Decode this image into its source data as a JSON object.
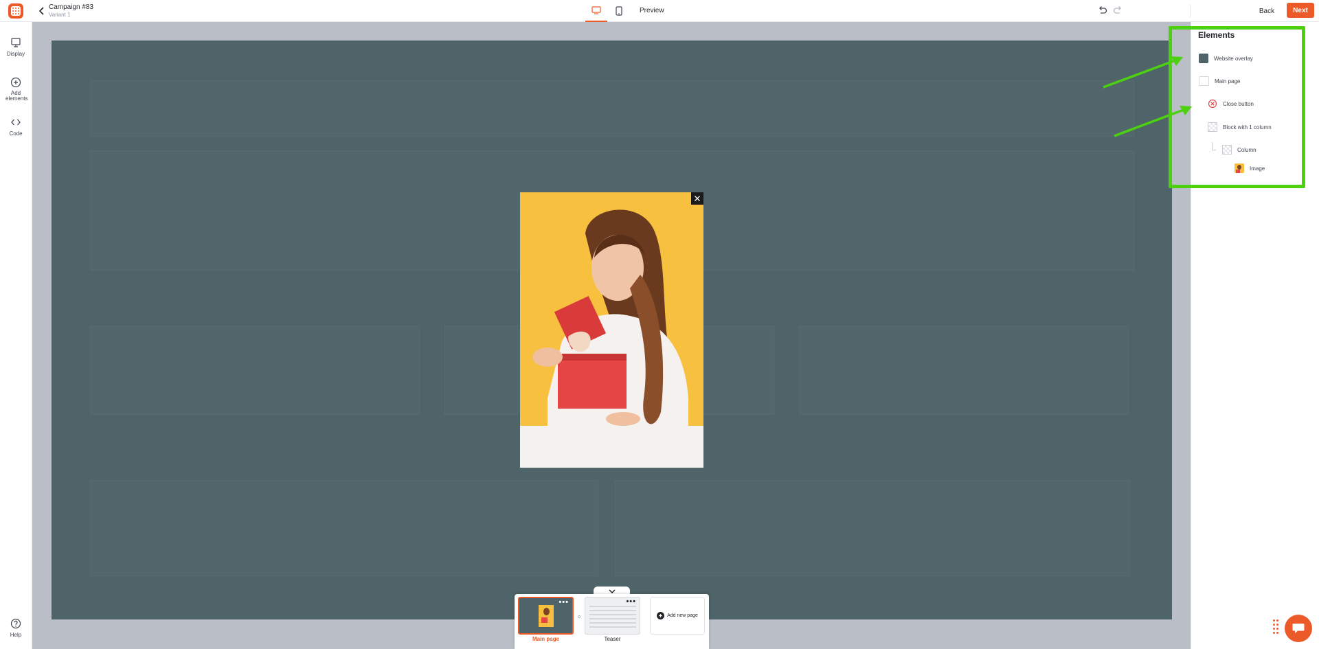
{
  "app": {
    "logo_icon": "omnisend-logo-icon",
    "accent_color": "#ed5a29"
  },
  "header": {
    "back_icon": "chevron-left-icon",
    "campaign_title": "Campaign #83",
    "variant": "Variant 1",
    "device_desktop_icon": "desktop-icon",
    "device_mobile_icon": "mobile-icon",
    "preview_label": "Preview",
    "undo_icon": "undo-icon",
    "redo_icon": "redo-icon",
    "back_label": "Back",
    "next_label": "Next"
  },
  "sidebar": {
    "items": [
      {
        "label": "Display",
        "icon": "monitor-icon"
      },
      {
        "label": "Add elements",
        "icon": "plus-circle-icon"
      },
      {
        "label": "Code",
        "icon": "code-icon"
      }
    ],
    "help_label": "Help"
  },
  "canvas": {
    "overlay_color": "#4e6468",
    "popup_image": "woman-with-gift-image",
    "close_icon": "close-icon"
  },
  "pages": {
    "items": [
      {
        "label": "Main page",
        "selected": true
      },
      {
        "label": "Teaser",
        "selected": false
      }
    ],
    "more_icon": "more-dots-icon",
    "add_label": "Add new page",
    "toggle_icon": "chevron-down-icon"
  },
  "elements_panel": {
    "title": "Elements",
    "items": [
      {
        "label": "Website overlay",
        "icon": "color-swatch-icon",
        "color": "#4e6468"
      },
      {
        "label": "Main page",
        "icon": "page-icon"
      },
      {
        "label": "Close button",
        "icon": "close-circle-icon"
      },
      {
        "label": "Block with 1 column",
        "icon": "transparent-block-icon"
      },
      {
        "label": "Column",
        "icon": "transparent-column-icon"
      },
      {
        "label": "Image",
        "icon": "image-thumbnail-icon"
      }
    ],
    "highlight_color": "#4cd00f"
  },
  "chat": {
    "icon": "chat-bubble-icon"
  }
}
